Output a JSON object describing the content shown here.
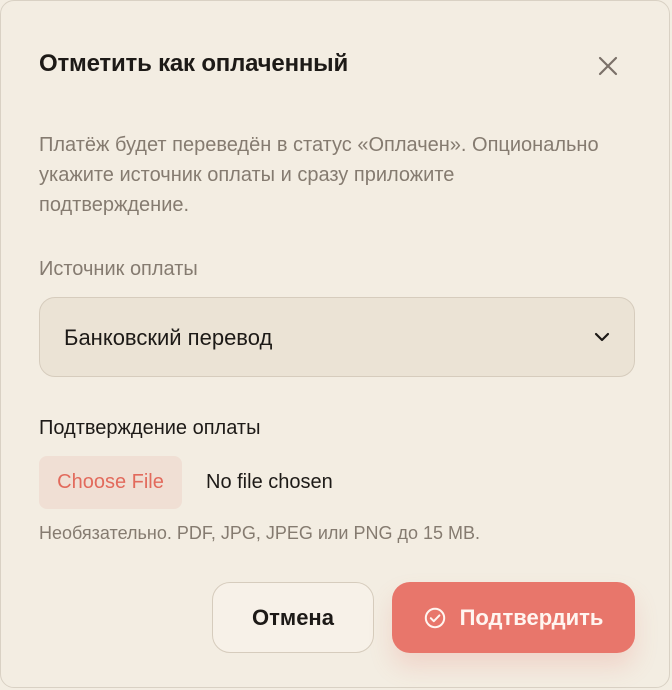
{
  "dialog": {
    "title": "Отметить как оплаченный",
    "close_icon": "close-icon",
    "description": "Платёж будет переведён в статус «Оплачен». Опционально укажите источник оплаты и сразу приложите подтверждение."
  },
  "payment_source": {
    "label": "Источник оплаты",
    "selected": "Банковский перевод",
    "icon": "chevron-down-icon"
  },
  "payment_confirmation": {
    "label": "Подтверждение оплаты",
    "choose_file_label": "Choose File",
    "file_status": "No file chosen",
    "hint": "Необязательно. PDF, JPG, JPEG или PNG до 15 MB."
  },
  "actions": {
    "cancel_label": "Отмена",
    "confirm_label": "Подтвердить",
    "confirm_icon": "check-circle-icon"
  },
  "colors": {
    "background": "#f3ede2",
    "accent": "#e8766b",
    "accent_light": "#f0dfd4",
    "text": "#1d1a17",
    "muted": "#857b70"
  }
}
